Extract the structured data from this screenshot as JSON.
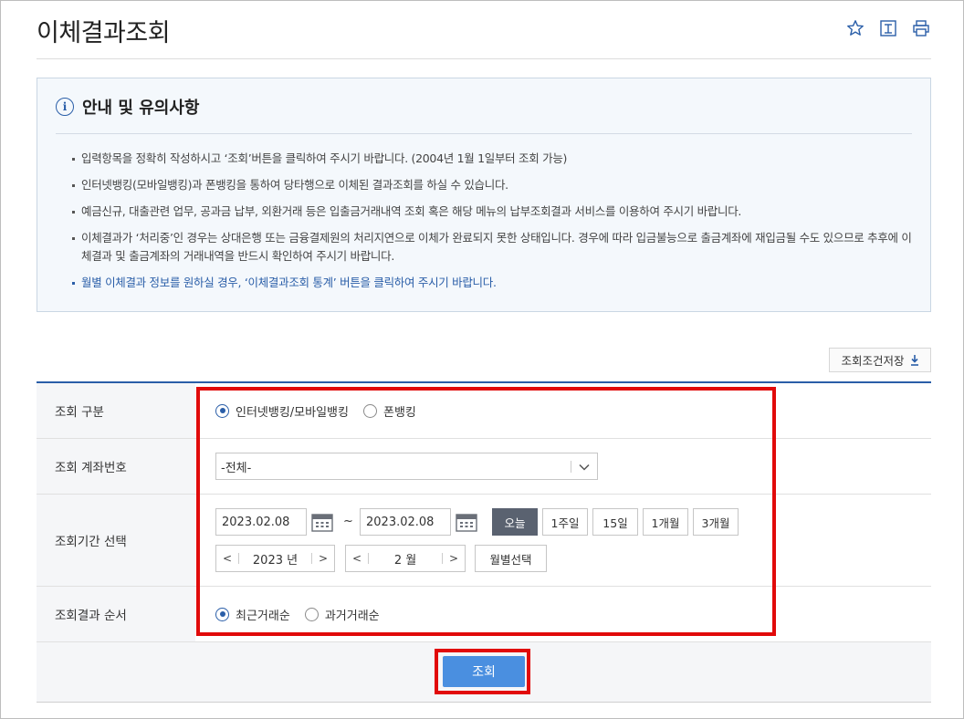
{
  "header": {
    "title": "이체결과조회",
    "icons": [
      "star-icon",
      "download-doc-icon",
      "print-icon"
    ]
  },
  "notice": {
    "title": "안내 및 유의사항",
    "items": [
      "입력항목을 정확히 작성하시고 ‘조회’버튼을 클릭하여 주시기 바랍니다. (2004년 1월 1일부터 조회 가능)",
      "인터넷뱅킹(모바일뱅킹)과 폰뱅킹을 통하여 당타행으로 이체된 결과조회를 하실 수 있습니다.",
      "예금신규, 대출관련 업무, 공과금 납부, 외환거래 등은 입출금거래내역 조회 혹은 해당 메뉴의 납부조회결과 서비스를 이용하여 주시기 바랍니다.",
      "이체결과가 ‘처리중’인 경우는 상대은행 또는 금융결제원의 처리지연으로 이체가 완료되지 못한 상태입니다. 경우에 따라 입금불능으로 출금계좌에 재입금될 수도 있으므로 추후에 이체결과 및 출금계좌의 거래내역을 반드시 확인하여 주시기 바랍니다.",
      "월별 이체결과 정보를 원하실 경우, ‘이체결과조회 통계’ 버튼을 클릭하여 주시기 바랍니다."
    ]
  },
  "save_condition": {
    "label": "조회조건저장"
  },
  "form": {
    "type": {
      "label": "조회 구분",
      "options": [
        "인터넷뱅킹/모바일뱅킹",
        "폰뱅킹"
      ],
      "selected": "인터넷뱅킹/모바일뱅킹"
    },
    "account": {
      "label": "조회 계좌번호",
      "selected": "-전체-"
    },
    "period": {
      "label": "조회기간 선택",
      "start": "2023.02.08",
      "tilde": "~",
      "end": "2023.02.08",
      "quick": [
        "오늘",
        "1주일",
        "15일",
        "1개월",
        "3개월"
      ],
      "active_quick": "오늘",
      "year": "2023 년",
      "month": "2 월",
      "month_select": "월별선택"
    },
    "order": {
      "label": "조회결과 순서",
      "options": [
        "최근거래순",
        "과거거래순"
      ],
      "selected": "최근거래순"
    }
  },
  "actions": {
    "search": "조회"
  },
  "colors": {
    "accent": "#2a5ea8",
    "highlight": "#e10a0a",
    "button": "#4a8fe0"
  }
}
